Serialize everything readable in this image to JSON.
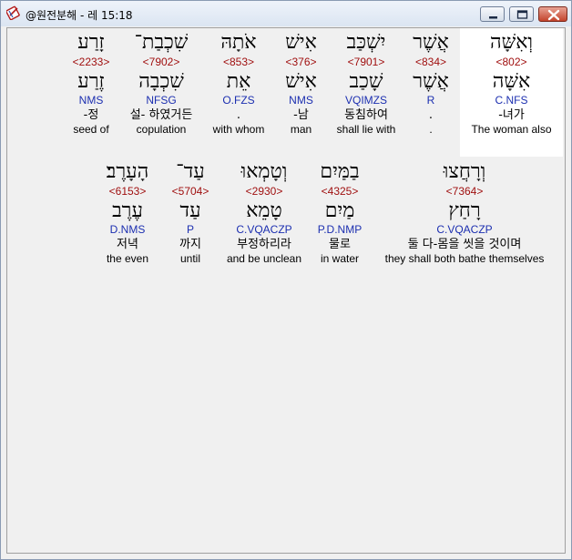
{
  "window": {
    "title": "@원전분해 - 레 15:18",
    "icon": "bible-book-icon"
  },
  "colors": {
    "strong_number": "#a01010",
    "parsing": "#1c2fb0",
    "selected_background": "#ffffff"
  },
  "verse": {
    "rows": [
      {
        "words": [
          {
            "hebrew": "וְאִשָּׁה",
            "strong": "<802>",
            "lemma": "אִשָּׁה",
            "parsing": "C.NFS",
            "korean": "-녀가",
            "english": "The woman also"
          },
          {
            "hebrew": "אֲשֶׁר",
            "strong": "<834>",
            "lemma": "אֲשֶׁר",
            "parsing": "R",
            "korean": ".",
            "english": "."
          },
          {
            "hebrew": "יִשְׁכַּב",
            "strong": "<7901>",
            "lemma": "שָׁכַב",
            "parsing": "VQIMZS",
            "korean": "동침하여",
            "english": "shall lie with"
          },
          {
            "hebrew": "אִישׁ",
            "strong": "<376>",
            "lemma": "אִישׁ",
            "parsing": "NMS",
            "korean": "-남",
            "english": "man"
          },
          {
            "hebrew": "אֹתָהּ",
            "strong": "<853>",
            "lemma": "אֵת",
            "parsing": "O.FZS",
            "korean": ".",
            "english": "with whom"
          },
          {
            "hebrew": "שִׁכְבַת־",
            "strong": "<7902>",
            "lemma": "שִׁכְבָה",
            "parsing": "NFSG",
            "korean": "설- 하였거든",
            "english": "copulation"
          },
          {
            "hebrew": "זָרַע",
            "strong": "<2233>",
            "lemma": "זֶרַע",
            "parsing": "NMS",
            "korean": "-정",
            "english": "seed of"
          }
        ]
      },
      {
        "words": [
          {
            "hebrew": "וְרָחֲצוּ",
            "strong": "<7364>",
            "lemma": "רָחַץ",
            "parsing": "C.VQACZP",
            "korean": "둘 다-몸을 씻을 것이며",
            "english": "they shall both bathe themselves"
          },
          {
            "hebrew": "בַמַּיִם",
            "strong": "<4325>",
            "lemma": "מַיִם",
            "parsing": "P.D.NMP",
            "korean": "물로",
            "english": "in water"
          },
          {
            "hebrew": "וְטָמְאוּ",
            "strong": "<2930>",
            "lemma": "טָמֵא",
            "parsing": "C.VQACZP",
            "korean": "부정하리라",
            "english": "and be unclean"
          },
          {
            "hebrew": "עַד־",
            "strong": "<5704>",
            "lemma": "עַד",
            "parsing": "P",
            "korean": "까지",
            "english": "until"
          },
          {
            "hebrew": "הָעָרֶב׃",
            "strong": "<6153>",
            "lemma": "עֶרֶב",
            "parsing": "D.NMS",
            "korean": "저녁",
            "english": "the even"
          }
        ]
      }
    ]
  }
}
